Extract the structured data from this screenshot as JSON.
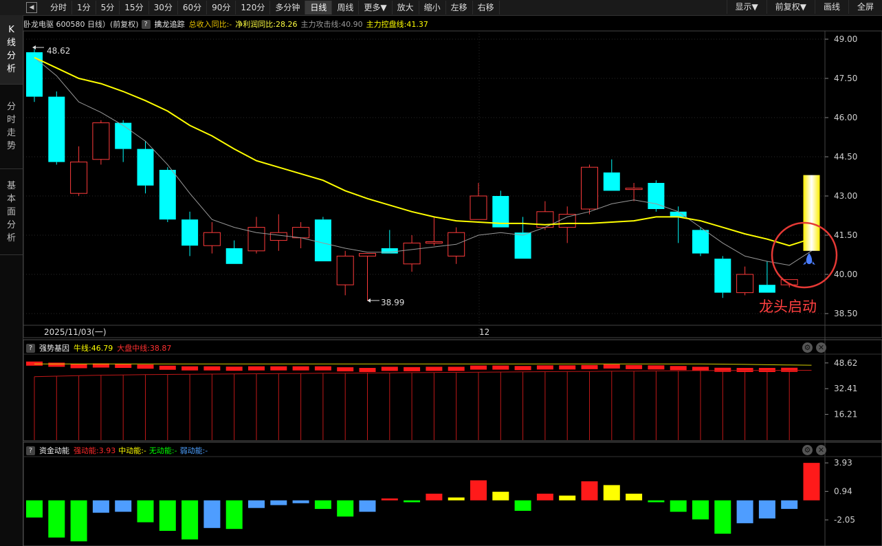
{
  "toolbar": {
    "buttons": [
      "分时",
      "1分",
      "5分",
      "15分",
      "30分",
      "60分",
      "90分",
      "120分",
      "多分钟",
      "日线",
      "周线",
      "更多▼",
      "放大",
      "缩小",
      "左移",
      "右移"
    ],
    "active_index": 9,
    "right_buttons": [
      "显示▼",
      "前复权▼",
      "画线",
      "全屏"
    ]
  },
  "sidebar": {
    "tabs": [
      {
        "label": "K线分析",
        "chars": [
          "K",
          "线",
          "分",
          "析"
        ]
      },
      {
        "label": "分时走势",
        "chars": [
          "分",
          "时",
          "走",
          "势"
        ]
      },
      {
        "label": "基本面分析",
        "chars": [
          "基",
          "本",
          "面",
          "分",
          "析"
        ]
      }
    ]
  },
  "header": {
    "title": "卧龙电驱 600580 日线）(前复权)",
    "indicator_name": "擒龙追踪",
    "items": [
      {
        "text": "总收入同比:-",
        "color": "#e8c300"
      },
      {
        "text": "净利润同比:28.26",
        "color": "#ffff40"
      },
      {
        "text": "主力攻击线:40.90",
        "color": "#9a9a9a"
      },
      {
        "text": "主力控盘线:41.37",
        "color": "#ffff00"
      }
    ]
  },
  "main_chart": {
    "y_ticks": [
      "49.00",
      "47.50",
      "46.00",
      "44.50",
      "43.00",
      "41.50",
      "40.00",
      "38.50"
    ],
    "date_label": "2025/11/03(一)",
    "month_label": "12",
    "high_label": "48.62",
    "low_label": "38.99",
    "annotation": "龙头启动",
    "colors": {
      "up": "#ff3b3b",
      "down": "#00ffff",
      "ma_yellow": "#ffff00",
      "ma_gray": "#999999",
      "signal": "#ffff00",
      "circle": "#e53935",
      "annotation": "#ff4040"
    }
  },
  "chart_data": {
    "type": "candlestick",
    "price_range": [
      38.5,
      49.0
    ],
    "candles": [
      {
        "o": 48.5,
        "h": 48.62,
        "l": 46.6,
        "c": 46.8
      },
      {
        "o": 46.8,
        "h": 47.0,
        "l": 44.2,
        "c": 44.3
      },
      {
        "o": 43.1,
        "h": 44.9,
        "l": 43.0,
        "c": 44.3
      },
      {
        "o": 44.4,
        "h": 45.9,
        "l": 44.2,
        "c": 45.8
      },
      {
        "o": 45.8,
        "h": 45.9,
        "l": 44.3,
        "c": 44.8
      },
      {
        "o": 44.8,
        "h": 45.1,
        "l": 43.1,
        "c": 43.4
      },
      {
        "o": 44.0,
        "h": 44.1,
        "l": 42.0,
        "c": 42.1
      },
      {
        "o": 42.1,
        "h": 42.4,
        "l": 40.7,
        "c": 41.1
      },
      {
        "o": 41.1,
        "h": 42.0,
        "l": 40.8,
        "c": 41.6
      },
      {
        "o": 41.0,
        "h": 41.3,
        "l": 40.4,
        "c": 40.4
      },
      {
        "o": 40.9,
        "h": 42.2,
        "l": 40.8,
        "c": 41.8
      },
      {
        "o": 41.3,
        "h": 42.3,
        "l": 40.9,
        "c": 41.6
      },
      {
        "o": 41.4,
        "h": 42.0,
        "l": 41.0,
        "c": 41.8
      },
      {
        "o": 42.1,
        "h": 42.2,
        "l": 40.5,
        "c": 40.5
      },
      {
        "o": 39.6,
        "h": 40.9,
        "l": 39.2,
        "c": 40.7
      },
      {
        "o": 40.7,
        "h": 40.8,
        "l": 38.99,
        "c": 40.8
      },
      {
        "o": 41.0,
        "h": 41.7,
        "l": 40.8,
        "c": 40.8
      },
      {
        "o": 40.4,
        "h": 41.5,
        "l": 40.1,
        "c": 41.2
      },
      {
        "o": 41.2,
        "h": 42.2,
        "l": 41.1,
        "c": 41.25
      },
      {
        "o": 40.7,
        "h": 41.8,
        "l": 40.4,
        "c": 41.6
      },
      {
        "o": 42.1,
        "h": 43.5,
        "l": 42.1,
        "c": 43.0
      },
      {
        "o": 43.0,
        "h": 43.2,
        "l": 41.8,
        "c": 41.8
      },
      {
        "o": 41.6,
        "h": 42.2,
        "l": 40.6,
        "c": 40.6
      },
      {
        "o": 41.8,
        "h": 42.8,
        "l": 41.7,
        "c": 42.4
      },
      {
        "o": 41.8,
        "h": 42.6,
        "l": 41.2,
        "c": 42.3
      },
      {
        "o": 42.5,
        "h": 44.2,
        "l": 42.3,
        "c": 44.1
      },
      {
        "o": 43.9,
        "h": 44.4,
        "l": 43.2,
        "c": 43.2
      },
      {
        "o": 43.3,
        "h": 43.5,
        "l": 42.8,
        "c": 43.3
      },
      {
        "o": 43.5,
        "h": 43.6,
        "l": 42.4,
        "c": 42.5
      },
      {
        "o": 42.4,
        "h": 42.6,
        "l": 41.2,
        "c": 42.2
      },
      {
        "o": 41.7,
        "h": 41.8,
        "l": 40.7,
        "c": 40.8
      },
      {
        "o": 40.6,
        "h": 40.7,
        "l": 39.1,
        "c": 39.3
      },
      {
        "o": 39.3,
        "h": 40.3,
        "l": 39.2,
        "c": 40.0
      },
      {
        "o": 39.6,
        "h": 40.5,
        "l": 39.3,
        "c": 39.3
      },
      {
        "o": 39.6,
        "h": 39.8,
        "l": 39.5,
        "c": 39.8
      }
    ],
    "ma_yellow": [
      48.3,
      47.9,
      47.5,
      47.3,
      47.0,
      46.65,
      46.25,
      45.7,
      45.3,
      44.8,
      44.35,
      44.1,
      43.85,
      43.6,
      43.2,
      42.9,
      42.65,
      42.4,
      42.2,
      42.05,
      42.0,
      41.95,
      41.95,
      41.9,
      41.95,
      41.95,
      42.0,
      42.05,
      42.2,
      42.2,
      42.05,
      41.8,
      41.55,
      41.35,
      41.1,
      41.37
    ],
    "ma_gray": [
      48.3,
      47.6,
      46.6,
      46.2,
      45.7,
      45.1,
      44.2,
      43.1,
      42.1,
      41.8,
      41.6,
      41.5,
      41.4,
      41.2,
      41.0,
      40.85,
      40.85,
      40.95,
      41.05,
      41.15,
      41.5,
      41.6,
      41.5,
      41.8,
      42.2,
      42.4,
      42.7,
      42.85,
      42.7,
      42.4,
      41.8,
      41.2,
      40.7,
      40.5,
      40.35,
      40.9
    ],
    "signal_bar": {
      "low": 40.9,
      "high": 43.8
    },
    "strength": {
      "name": "强势基因",
      "bull_line_label": "牛线:46.79",
      "mid_line_label": "大盘中线:38.87",
      "y_ticks": [
        "48.62",
        "32.41",
        "16.21"
      ],
      "range": [
        0,
        52
      ],
      "bars": [
        48.2,
        47.5,
        46.6,
        47.0,
        46.8,
        46.3,
        45.6,
        45.2,
        45.2,
        45.0,
        45.2,
        45.2,
        45.2,
        45.2,
        44.6,
        44.2,
        44.9,
        44.7,
        44.9,
        44.9,
        45.7,
        45.7,
        45.4,
        45.8,
        45.8,
        46.0,
        46.4,
        46.0,
        45.8,
        45.4,
        44.9,
        44.3,
        44.2,
        44.2,
        44.3,
        45.8
      ],
      "bull_line": [
        48.0,
        48.0,
        48.0,
        48.0,
        48.0,
        48.0,
        48.0,
        48.0,
        48.0,
        48.0,
        48.0,
        48.0,
        48.0,
        48.0,
        48.0,
        48.0,
        48.0,
        48.0,
        48.0,
        48.0,
        48.0,
        48.0,
        48.0,
        48.0,
        48.0,
        48.0,
        48.0,
        48.0,
        48.0,
        48.0,
        48.0,
        47.9,
        47.7,
        47.5,
        47.3,
        47.2
      ],
      "mid_line": [
        40.0,
        40.3,
        40.6,
        40.9,
        41.1,
        41.3,
        41.4,
        41.5,
        41.6,
        41.7,
        41.8,
        41.9,
        42.0,
        42.1,
        42.2,
        42.3,
        42.4,
        42.5,
        42.6,
        42.7,
        42.8,
        42.9,
        43.0,
        43.1,
        43.2,
        43.3,
        43.4,
        43.5,
        43.6,
        43.7,
        43.8,
        43.8,
        43.9,
        43.9,
        44.0,
        44.0
      ],
      "bottom_line": 38.87
    },
    "capital": {
      "name": "资金动能",
      "labels": [
        {
          "text": "强动能:3.93",
          "color": "#ff2a2a"
        },
        {
          "text": "中动能:-",
          "color": "#ffff00"
        },
        {
          "text": "无动能:-",
          "color": "#00ff00"
        },
        {
          "text": "弱动能:-",
          "color": "#4ea1ff"
        }
      ],
      "y_ticks": [
        "3.93",
        "0.94",
        "-2.05"
      ],
      "range": [
        -4.5,
        4.3
      ],
      "bars": [
        {
          "v": -1.8,
          "c": "green"
        },
        {
          "v": -3.9,
          "c": "green"
        },
        {
          "v": -4.3,
          "c": "green"
        },
        {
          "v": -1.3,
          "c": "blue"
        },
        {
          "v": -1.2,
          "c": "blue"
        },
        {
          "v": -2.3,
          "c": "green"
        },
        {
          "v": -3.2,
          "c": "green"
        },
        {
          "v": -4.1,
          "c": "green"
        },
        {
          "v": -2.9,
          "c": "blue"
        },
        {
          "v": -3.0,
          "c": "green"
        },
        {
          "v": -0.8,
          "c": "blue"
        },
        {
          "v": -0.5,
          "c": "blue"
        },
        {
          "v": -0.3,
          "c": "blue"
        },
        {
          "v": -0.9,
          "c": "green"
        },
        {
          "v": -1.7,
          "c": "green"
        },
        {
          "v": -1.2,
          "c": "blue"
        },
        {
          "v": 0.2,
          "c": "red"
        },
        {
          "v": -0.2,
          "c": "green"
        },
        {
          "v": 0.7,
          "c": "red"
        },
        {
          "v": 0.3,
          "c": "yellow"
        },
        {
          "v": 2.1,
          "c": "red"
        },
        {
          "v": 0.9,
          "c": "yellow"
        },
        {
          "v": -1.1,
          "c": "green"
        },
        {
          "v": 0.7,
          "c": "red"
        },
        {
          "v": 0.5,
          "c": "yellow"
        },
        {
          "v": 2.0,
          "c": "red"
        },
        {
          "v": 1.6,
          "c": "yellow"
        },
        {
          "v": 0.7,
          "c": "yellow"
        },
        {
          "v": -0.2,
          "c": "green"
        },
        {
          "v": -1.2,
          "c": "green"
        },
        {
          "v": -2.0,
          "c": "green"
        },
        {
          "v": -3.5,
          "c": "green"
        },
        {
          "v": -2.4,
          "c": "blue"
        },
        {
          "v": -1.9,
          "c": "blue"
        },
        {
          "v": -0.9,
          "c": "blue"
        },
        {
          "v": 3.93,
          "c": "red"
        }
      ]
    }
  }
}
